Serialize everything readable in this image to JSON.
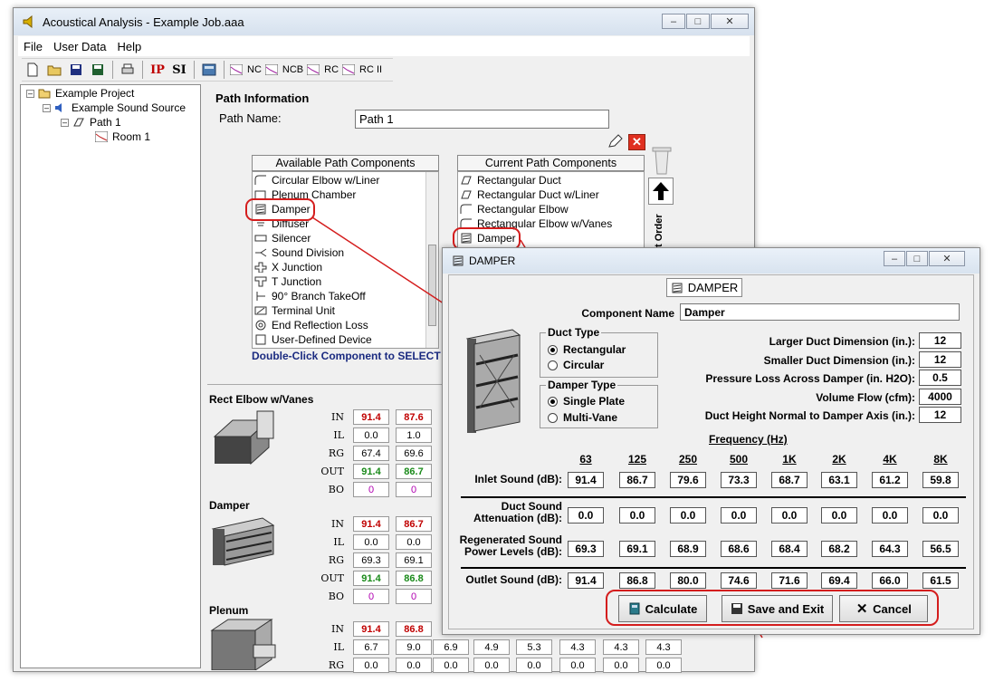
{
  "main_window": {
    "title": "Acoustical Analysis - Example Job.aaa",
    "menu": [
      "File",
      "User Data",
      "Help"
    ],
    "toolbar": {
      "ip": "IP",
      "si": "SI",
      "nc": "NC",
      "ncb": "NCB",
      "rc": "RC",
      "rc2": "RC II"
    }
  },
  "tree": {
    "items": [
      "Example Project",
      "Example Sound Source",
      "Path 1",
      "Room 1"
    ]
  },
  "path_info": {
    "title": "Path Information",
    "name_label": "Path Name:",
    "name_value": "Path 1"
  },
  "available": {
    "header": "Available Path Components",
    "items": [
      "Circular Elbow w/Liner",
      "Plenum Chamber",
      "Damper",
      "Diffuser",
      "Silencer",
      "Sound Division",
      "X Junction",
      "T Junction",
      "90° Branch TakeOff",
      "Terminal Unit",
      "End Reflection Loss",
      "User-Defined Device"
    ],
    "hint": "Double-Click Component to SELECT"
  },
  "current": {
    "header": "Current Path Components",
    "items": [
      "Rectangular Duct",
      "Rectangular Duct w/Liner",
      "Rectangular Elbow",
      "Rectangular Elbow w/Vanes",
      "Damper"
    ],
    "order_label": "t Order"
  },
  "bg_sections": [
    {
      "title": "Rect Elbow w/Vanes",
      "rows": [
        {
          "label": "IN",
          "values": [
            "91.4",
            "87.6"
          ]
        },
        {
          "label": "IL",
          "values": [
            "0.0",
            "1.0"
          ]
        },
        {
          "label": "RG",
          "values": [
            "67.4",
            "69.6"
          ]
        },
        {
          "label": "OUT",
          "values": [
            "91.4",
            "86.7"
          ]
        },
        {
          "label": "BO",
          "values": [
            "0",
            "0"
          ]
        }
      ]
    },
    {
      "title": "Damper",
      "rows": [
        {
          "label": "IN",
          "values": [
            "91.4",
            "86.7"
          ]
        },
        {
          "label": "IL",
          "values": [
            "0.0",
            "0.0"
          ]
        },
        {
          "label": "RG",
          "values": [
            "69.3",
            "69.1"
          ]
        },
        {
          "label": "OUT",
          "values": [
            "91.4",
            "86.8"
          ]
        },
        {
          "label": "BO",
          "values": [
            "0",
            "0"
          ]
        }
      ]
    },
    {
      "title": "Plenum",
      "rows": [
        {
          "label": "IN",
          "values": [
            "91.4",
            "86.8"
          ]
        },
        {
          "label": "IL",
          "values": [
            "6.7",
            "9.0",
            "6.9",
            "4.9",
            "5.3",
            "4.3",
            "4.3",
            "4.3"
          ]
        },
        {
          "label": "RG",
          "values": [
            "0.0",
            "0.0",
            "0.0",
            "0.0",
            "0.0",
            "0.0",
            "0.0",
            "0.0"
          ]
        }
      ]
    }
  ],
  "dialog": {
    "title": "DAMPER",
    "tab": "DAMPER",
    "component_name_label": "Component Name",
    "component_name": "Damper",
    "duct_type": {
      "title": "Duct Type",
      "options": [
        "Rectangular",
        "Circular"
      ],
      "selected": "Rectangular"
    },
    "damper_type": {
      "title": "Damper Type",
      "options": [
        "Single Plate",
        "Multi-Vane"
      ],
      "selected": "Single Plate"
    },
    "params": [
      {
        "label": "Larger Duct Dimension (in.):",
        "value": "12"
      },
      {
        "label": "Smaller Duct Dimension (in.):",
        "value": "12"
      },
      {
        "label": "Pressure Loss Across Damper (in. H2O):",
        "value": "0.5"
      },
      {
        "label": "Volume Flow (cfm):",
        "value": "4000"
      },
      {
        "label": "Duct Height Normal to Damper Axis (in.):",
        "value": "12"
      }
    ],
    "freq_title": "Frequency (Hz)",
    "freqs": [
      "63",
      "125",
      "250",
      "500",
      "1K",
      "2K",
      "4K",
      "8K"
    ],
    "rows": [
      {
        "label": "Inlet Sound (dB):",
        "values": [
          "91.4",
          "86.7",
          "79.6",
          "73.3",
          "68.7",
          "63.1",
          "61.2",
          "59.8"
        ]
      },
      {
        "label": "Duct Sound Attenuation (dB):",
        "values": [
          "0.0",
          "0.0",
          "0.0",
          "0.0",
          "0.0",
          "0.0",
          "0.0",
          "0.0"
        ]
      },
      {
        "label": "Regenerated Sound Power Levels (dB):",
        "values": [
          "69.3",
          "69.1",
          "68.9",
          "68.6",
          "68.4",
          "68.2",
          "64.3",
          "56.5"
        ]
      },
      {
        "label": "Outlet Sound (dB):",
        "values": [
          "91.4",
          "86.8",
          "80.0",
          "74.6",
          "71.6",
          "69.4",
          "66.0",
          "61.5"
        ]
      }
    ],
    "buttons": {
      "calculate": "Calculate",
      "save": "Save and Exit",
      "cancel": "Cancel"
    }
  },
  "colors": {
    "accent_red": "#d41d1d",
    "in_red": "#c00000",
    "out_green": "#1a8a1a",
    "bo_purple": "#b000b0"
  }
}
